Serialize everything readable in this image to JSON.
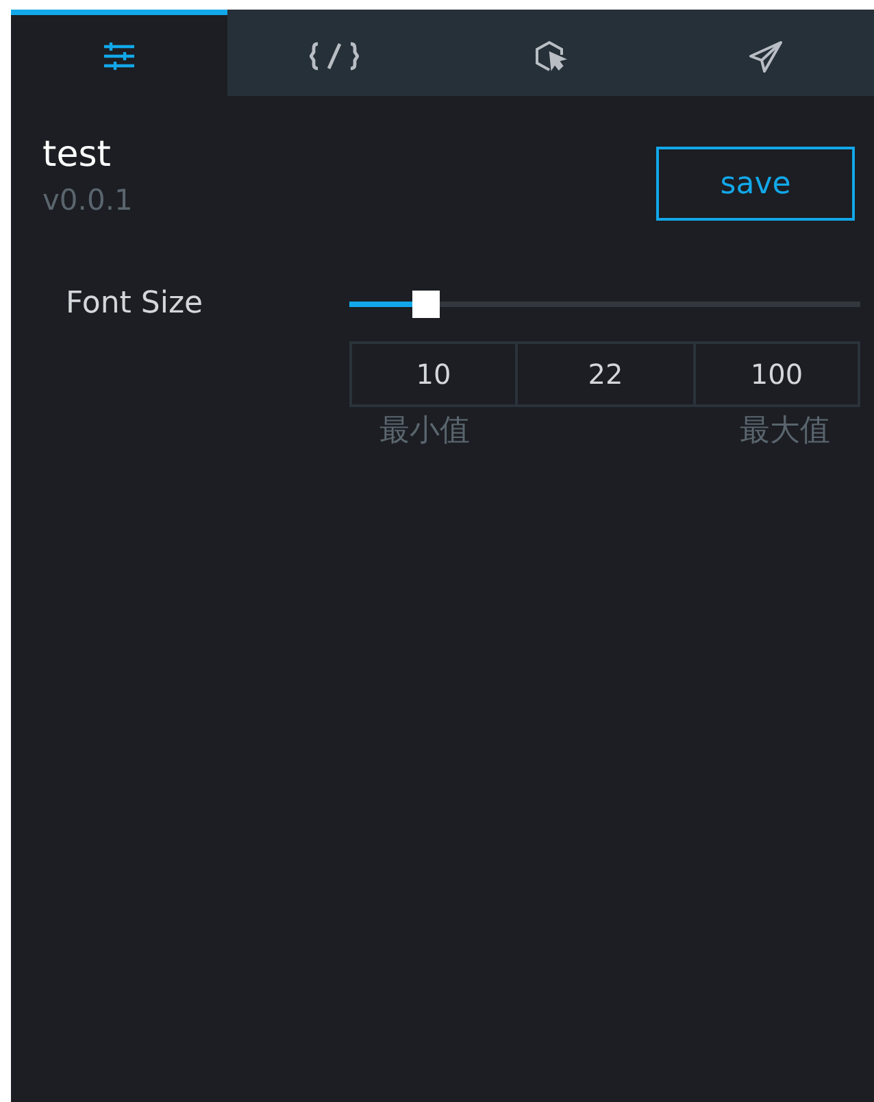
{
  "tabs": [
    {
      "selected": true
    },
    {
      "selected": false
    },
    {
      "selected": false
    },
    {
      "selected": false
    }
  ],
  "plugin": {
    "name": "test",
    "version": "v0.0.1"
  },
  "save_button": "save",
  "settings": [
    {
      "label": "Font Size",
      "level": 0.15,
      "min": "10",
      "value": "22",
      "max": "100",
      "min_label": "最小值",
      "max_label": "最大值"
    }
  ]
}
